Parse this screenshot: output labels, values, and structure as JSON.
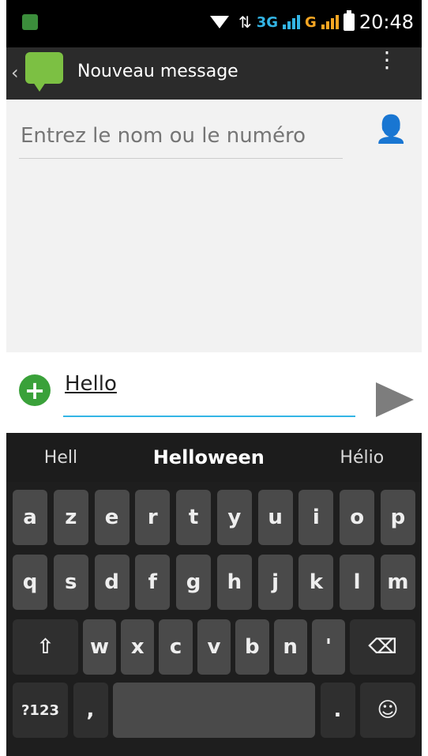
{
  "status_bar": {
    "time": "20:48",
    "network_label": "3G",
    "network_label2": "G"
  },
  "action_bar": {
    "title": "Nouveau message"
  },
  "recipient": {
    "placeholder": "Entrez le nom ou le numéro"
  },
  "compose": {
    "value": "Hello"
  },
  "keyboard": {
    "suggestions": [
      "Hell",
      "Helloween",
      "Hélio"
    ],
    "row1": [
      "a",
      "z",
      "e",
      "r",
      "t",
      "y",
      "u",
      "i",
      "o",
      "p"
    ],
    "row2": [
      "q",
      "s",
      "d",
      "f",
      "g",
      "h",
      "j",
      "k",
      "l",
      "m"
    ],
    "row3": [
      "w",
      "x",
      "c",
      "v",
      "b",
      "n",
      "'"
    ],
    "sym_label": "?123",
    "comma": ",",
    "period": "."
  }
}
